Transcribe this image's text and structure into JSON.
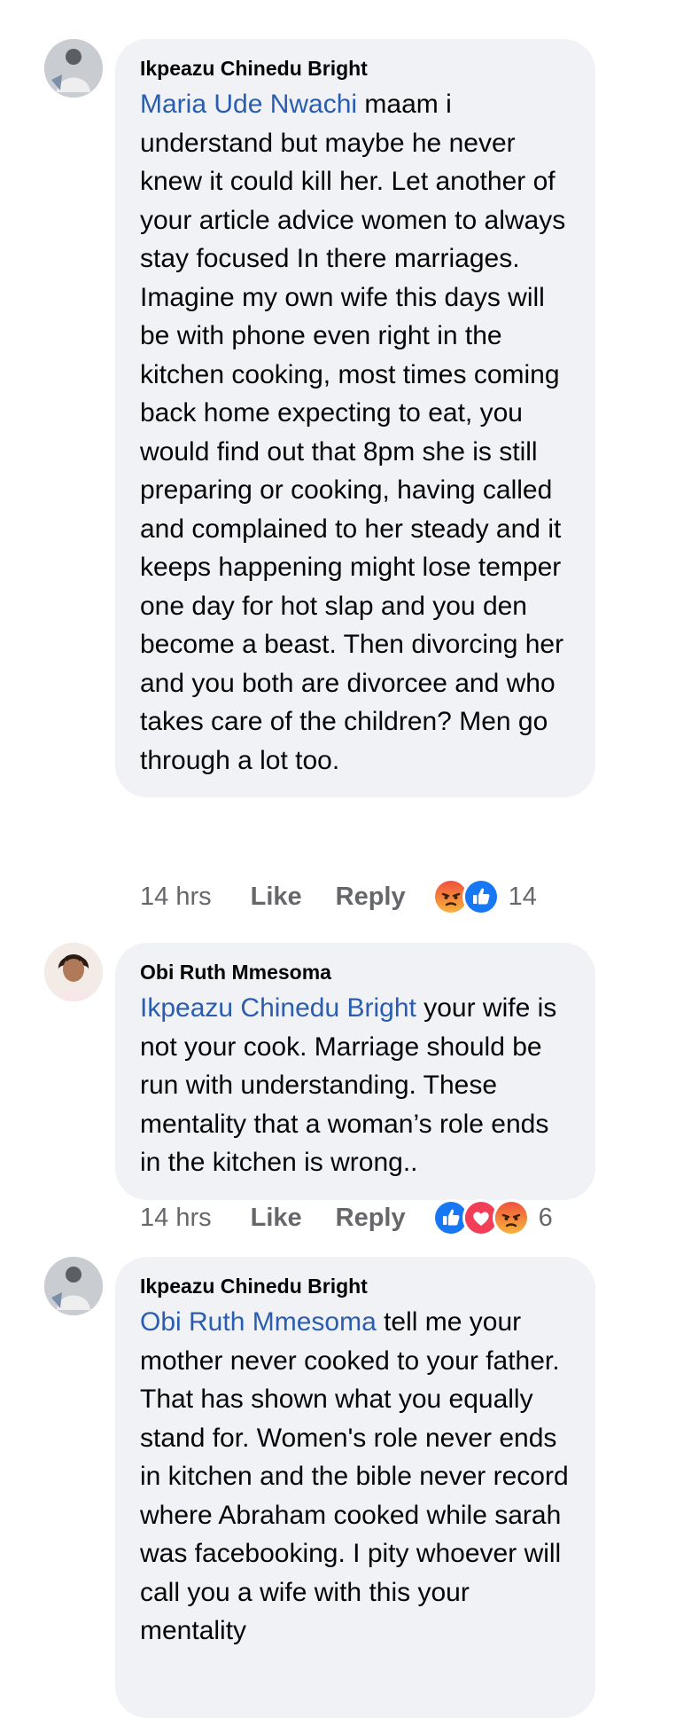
{
  "comments": [
    {
      "author": "Ikpeazu Chinedu Bright",
      "mention": "Maria Ude Nwachi",
      "text": " maam i understand but maybe he never knew it could kill her. Let another of your article advice women to always stay focused In there marriages. Imagine my own wife this days will be with phone even right in the kitchen cooking, most times coming back home expecting to eat, you would find out that 8pm she is still preparing or cooking, having called and complained to her steady and it keeps happening might lose temper one day for hot slap and you den become a beast. Then divorcing her and you both are divorcee and who takes care of the children? Men go through a lot too.",
      "time": "14 hrs",
      "like_label": "Like",
      "reply_label": "Reply",
      "reactions": [
        "angry",
        "like"
      ],
      "reaction_count": "14"
    },
    {
      "author": "Obi Ruth Mmesoma",
      "mention": "Ikpeazu Chinedu Bright",
      "text": " your wife is not your cook. Marriage should be run with understanding. These mentality that a woman’s role ends in the kitchen is wrong..",
      "time": "14 hrs",
      "like_label": "Like",
      "reply_label": "Reply",
      "reactions": [
        "like",
        "love",
        "angry"
      ],
      "reaction_count": "6"
    },
    {
      "author": "Ikpeazu Chinedu Bright",
      "mention": "Obi Ruth Mmesoma",
      "text": " tell me your mother never cooked to your father. That has shown what you equally stand for. Women's role never ends in kitchen and the bible never record where Abraham cooked while sarah was facebooking. I pity whoever will call you a wife with this your mentality"
    }
  ],
  "colors": {
    "bubble": "#f0f2f5",
    "mention": "#2a5db0",
    "meta": "#65676b",
    "like_blue": "#1877f2",
    "love_red": "#f33e58",
    "angry_orange": "#e9710f"
  }
}
